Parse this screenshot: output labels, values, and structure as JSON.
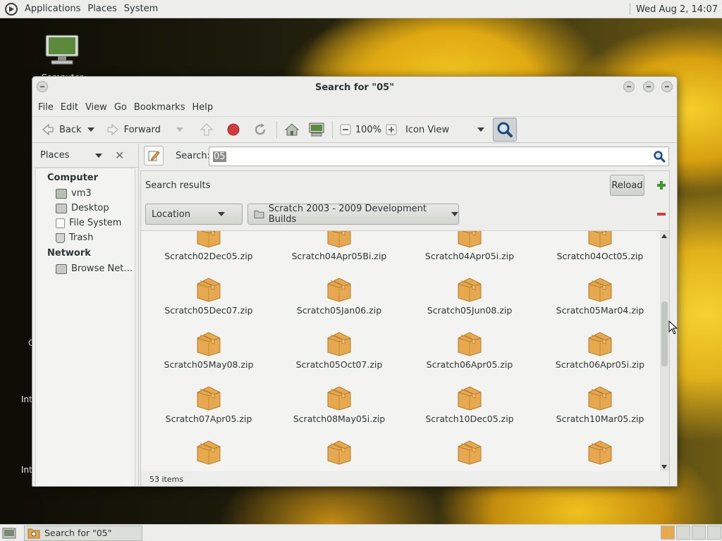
{
  "top_panel": {
    "menus": [
      "Applications",
      "Places",
      "System"
    ],
    "clock": "Wed Aug  2, 14:07"
  },
  "desktop": {
    "icons": [
      {
        "label": "Computer"
      }
    ],
    "partial_labels": [
      "C",
      "Int",
      "Int"
    ]
  },
  "window": {
    "title": "Search for \"05\"",
    "menubar": [
      "File",
      "Edit",
      "View",
      "Go",
      "Bookmarks",
      "Help"
    ],
    "toolbar": {
      "back": "Back",
      "forward": "Forward",
      "zoom": "100%",
      "view_mode": "Icon View"
    },
    "sidepane": {
      "title": "Places",
      "sections": [
        {
          "heading": "Computer",
          "items": [
            {
              "label": "vm3",
              "icon": "home-folder-icon"
            },
            {
              "label": "Desktop",
              "icon": "desktop-folder-icon"
            },
            {
              "label": "File System",
              "icon": "filesystem-icon"
            },
            {
              "label": "Trash",
              "icon": "trash-icon"
            }
          ]
        },
        {
          "heading": "Network",
          "items": [
            {
              "label": "Browse Net…",
              "icon": "network-icon"
            }
          ]
        }
      ]
    },
    "search": {
      "label": "Search:",
      "query": "05"
    },
    "results": {
      "heading": "Search results",
      "reload": "Reload",
      "filter_type": "Location",
      "filter_value": "Scratch 2003 - 2009 Development Builds",
      "status": "53 items",
      "rows": [
        [
          "Scratch02Dec05.zip",
          "Scratch04Apr05Bi.zip",
          "Scratch04Apr05i.zip",
          "Scratch04Oct05.zip"
        ],
        [
          "Scratch05Dec07.zip",
          "Scratch05Jan06.zip",
          "Scratch05Jun08.zip",
          "Scratch05Mar04.zip"
        ],
        [
          "Scratch05May08.zip",
          "Scratch05Oct07.zip",
          "Scratch06Apr05.zip",
          "Scratch06Apr05i.zip"
        ],
        [
          "Scratch07Apr05.zip",
          "Scratch08May05i.zip",
          "Scratch10Dec05.zip",
          "Scratch10Mar05.zip"
        ],
        [
          "",
          "",
          "",
          ""
        ]
      ]
    }
  },
  "taskbar": {
    "task_label": "Search for \"05\""
  },
  "colors": {
    "panel_bg": "#edeeeb",
    "package_icon": "#e7a94f",
    "search_icon": "#1f4a7a",
    "stop_icon": "#d23b3b",
    "add_icon": "#3a9a2b",
    "remove_icon": "#d23b3b"
  }
}
